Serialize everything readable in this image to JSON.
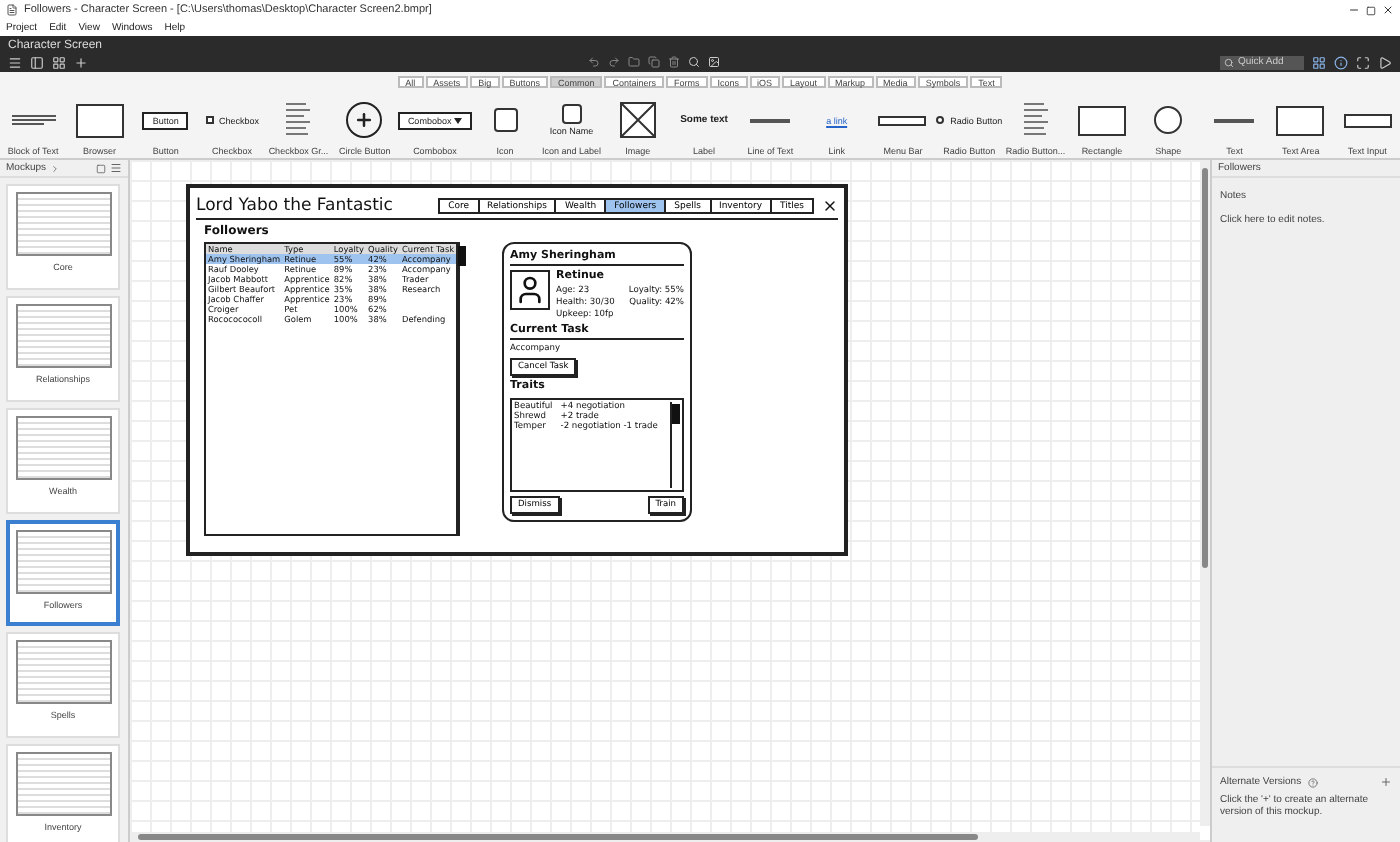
{
  "window": {
    "title": "Followers - Character Screen - [C:\\Users\\thomas\\Desktop\\Character Screen2.bmpr]"
  },
  "menu": [
    "Project",
    "Edit",
    "View",
    "Windows",
    "Help"
  ],
  "project": {
    "title": "Character Screen",
    "search": {
      "placeholder": "Quick Add"
    }
  },
  "filters": [
    {
      "label": "All",
      "selected": false
    },
    {
      "label": "Assets",
      "selected": false
    },
    {
      "label": "Big",
      "selected": false
    },
    {
      "label": "Buttons",
      "selected": false
    },
    {
      "label": "Common",
      "selected": true
    },
    {
      "label": "Containers",
      "selected": false
    },
    {
      "label": "Forms",
      "selected": false
    },
    {
      "label": "Icons",
      "selected": false
    },
    {
      "label": "iOS",
      "selected": false
    },
    {
      "label": "Layout",
      "selected": false
    },
    {
      "label": "Markup",
      "selected": false
    },
    {
      "label": "Media",
      "selected": false
    },
    {
      "label": "Symbols",
      "selected": false
    },
    {
      "label": "Text",
      "selected": false
    }
  ],
  "library": [
    {
      "label": "Block of Text",
      "kind": "lines"
    },
    {
      "label": "Browser",
      "kind": "browser"
    },
    {
      "label": "Button",
      "kind": "button",
      "sample": "Button"
    },
    {
      "label": "Checkbox",
      "kind": "checkbox",
      "sample": "Checkbox"
    },
    {
      "label": "Checkbox Gr...",
      "kind": "list"
    },
    {
      "label": "Circle Button",
      "kind": "circle"
    },
    {
      "label": "Combobox",
      "kind": "combo",
      "sample": "Combobox"
    },
    {
      "label": "Icon",
      "kind": "square"
    },
    {
      "label": "Icon and Label",
      "kind": "iconlabel",
      "sample": "Icon Name"
    },
    {
      "label": "Image",
      "kind": "image"
    },
    {
      "label": "Label",
      "kind": "label",
      "sample": "Some text"
    },
    {
      "label": "Line of Text",
      "kind": "line"
    },
    {
      "label": "Link",
      "kind": "link",
      "sample": "a link"
    },
    {
      "label": "Menu Bar",
      "kind": "menubar"
    },
    {
      "label": "Radio Button",
      "kind": "radio",
      "sample": "Radio Button"
    },
    {
      "label": "Radio Button...",
      "kind": "list"
    },
    {
      "label": "Rectangle",
      "kind": "rect"
    },
    {
      "label": "Shape",
      "kind": "shape"
    },
    {
      "label": "Text",
      "kind": "line"
    },
    {
      "label": "Text Area",
      "kind": "textarea"
    },
    {
      "label": "Text Input",
      "kind": "input"
    }
  ],
  "mockups": {
    "title": "Mockups",
    "items": [
      {
        "label": "Core",
        "selected": false
      },
      {
        "label": "Relationships",
        "selected": false
      },
      {
        "label": "Wealth",
        "selected": false
      },
      {
        "label": "Followers",
        "selected": true
      },
      {
        "label": "Spells",
        "selected": false
      },
      {
        "label": "Inventory",
        "selected": false
      }
    ]
  },
  "mockup": {
    "title": "Lord Yabo the Fantastic",
    "tabs": [
      {
        "label": "Core",
        "selected": false
      },
      {
        "label": "Relationships",
        "selected": false
      },
      {
        "label": "Wealth",
        "selected": false
      },
      {
        "label": "Followers",
        "selected": true
      },
      {
        "label": "Spells",
        "selected": false
      },
      {
        "label": "Inventory",
        "selected": false
      },
      {
        "label": "Titles",
        "selected": false
      }
    ],
    "section": "Followers",
    "table": {
      "columns": [
        "Name",
        "Type",
        "Loyalty",
        "Quality",
        "Current Task"
      ],
      "rows": [
        {
          "cells": [
            "Amy Sheringham",
            "Retinue",
            "55%",
            "42%",
            "Accompany"
          ],
          "selected": true
        },
        {
          "cells": [
            "Rauf Dooley",
            "Retinue",
            "89%",
            "23%",
            "Accompany"
          ],
          "selected": false
        },
        {
          "cells": [
            "Jacob Mabbott",
            "Apprentice",
            "82%",
            "38%",
            "Trader"
          ],
          "selected": false
        },
        {
          "cells": [
            "Gilbert Beaufort",
            "Apprentice",
            "35%",
            "38%",
            "Research"
          ],
          "selected": false
        },
        {
          "cells": [
            "Jacob Chaffer",
            "Apprentice",
            "23%",
            "89%"
          ],
          "selected": false
        },
        {
          "cells": [
            "Croiger",
            "Pet",
            "100%",
            "62%"
          ],
          "selected": false
        },
        {
          "cells": [
            "Rococococoll",
            "Golem",
            "100%",
            "38%",
            "Defending"
          ],
          "selected": false
        }
      ]
    },
    "card": {
      "name": "Amy Sheringham",
      "type": "Retinue",
      "age": "Age: 23",
      "loyalty": "Loyalty: 55%",
      "health": "Health: 30/30",
      "quality": "Quality: 42%",
      "upkeep": "Upkeep: 10fp",
      "task_heading": "Current Task",
      "task": "Accompany",
      "cancel": "Cancel Task",
      "traits_heading": "Traits",
      "traits": [
        {
          "name": "Beautiful",
          "effect": "+4 negotiation"
        },
        {
          "name": "Shrewd",
          "effect": "+2 trade"
        },
        {
          "name": "Temper",
          "effect": "-2 negotiation -1 trade"
        }
      ],
      "buttons": [
        "Dismiss",
        "Train"
      ]
    }
  },
  "notes": {
    "title": "Followers",
    "heading": "Notes",
    "hint": "Click here to edit notes.",
    "versions_title": "Alternate Versions",
    "versions_hint": "Click the '+' to create an alternate version of this mockup."
  }
}
